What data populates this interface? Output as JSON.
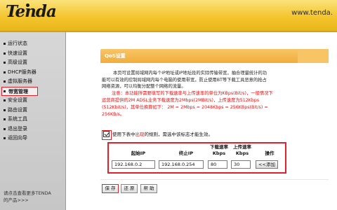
{
  "header": {
    "logo_text": "Tenda",
    "url": "www.tenda."
  },
  "sidebar": {
    "items": [
      {
        "label": "运行状态"
      },
      {
        "label": "快速设置"
      },
      {
        "label": "高级设置"
      },
      {
        "label": "DHCP服务器"
      },
      {
        "label": "虚拟服务器"
      },
      {
        "label": "带宽管理",
        "active": true
      },
      {
        "label": "安全设置"
      },
      {
        "label": "路由设置"
      },
      {
        "label": "系统工具"
      },
      {
        "label": "退出登录"
      },
      {
        "label": "返回向导"
      }
    ],
    "note_line1": "请点击查看更多TENDA",
    "note_line2": "的产品>>>"
  },
  "panel": {
    "title": "QoS设置"
  },
  "description": {
    "line1": "本页可设置局域网内每个IP地址或IP地址段的实际传输带宽，抽合理量统计的功",
    "line2": "能可以有效的控制局域网内每个电脑的使用带宽，防止使用BT等下载工具恶意的抢占",
    "line3": "网络资源，可以均衡分配整个网络的流量。",
    "note1": "注意：本功能所需要填写的下载速率与上传速率的单位为KBps(Bit/s)，一般情况下",
    "note2": "运营商提供的2M ADSL业务下载速度为2Mbps(2MBit/s)，上传速度为512Kbps",
    "note3": "(512Kbit/s)，其单位换算如下： 2M = 2Mbps = 2048Kbps = 256KBps(Bit/s) =",
    "note4": "256KB/s。"
  },
  "checkbox": {
    "checked": true,
    "label_pre": "使用下表中",
    "label_hl": "出现",
    "label_post": "的规则，需选中该标志才能生效。"
  },
  "table": {
    "headers": {
      "start_ip": "起始IP",
      "end_ip": "终止IP",
      "down_line1": "下载速率",
      "down_line2": "Kbps",
      "up_line1": "上传速率",
      "up_line2": "Kbps",
      "action": "操作"
    },
    "row": {
      "start_ip": "192.168.0.2",
      "end_ip": "192.168.0.254",
      "download": "80",
      "upload": "30",
      "add_label": "<<添加"
    }
  },
  "buttons": {
    "save": "保 存",
    "restore": "还 原",
    "help": "帮 助"
  },
  "colors": {
    "header_yellow": "#f4c52c",
    "panel_orange": "#f0ad3c",
    "highlight_red": "#e0202a",
    "note_red": "#dd1111"
  }
}
